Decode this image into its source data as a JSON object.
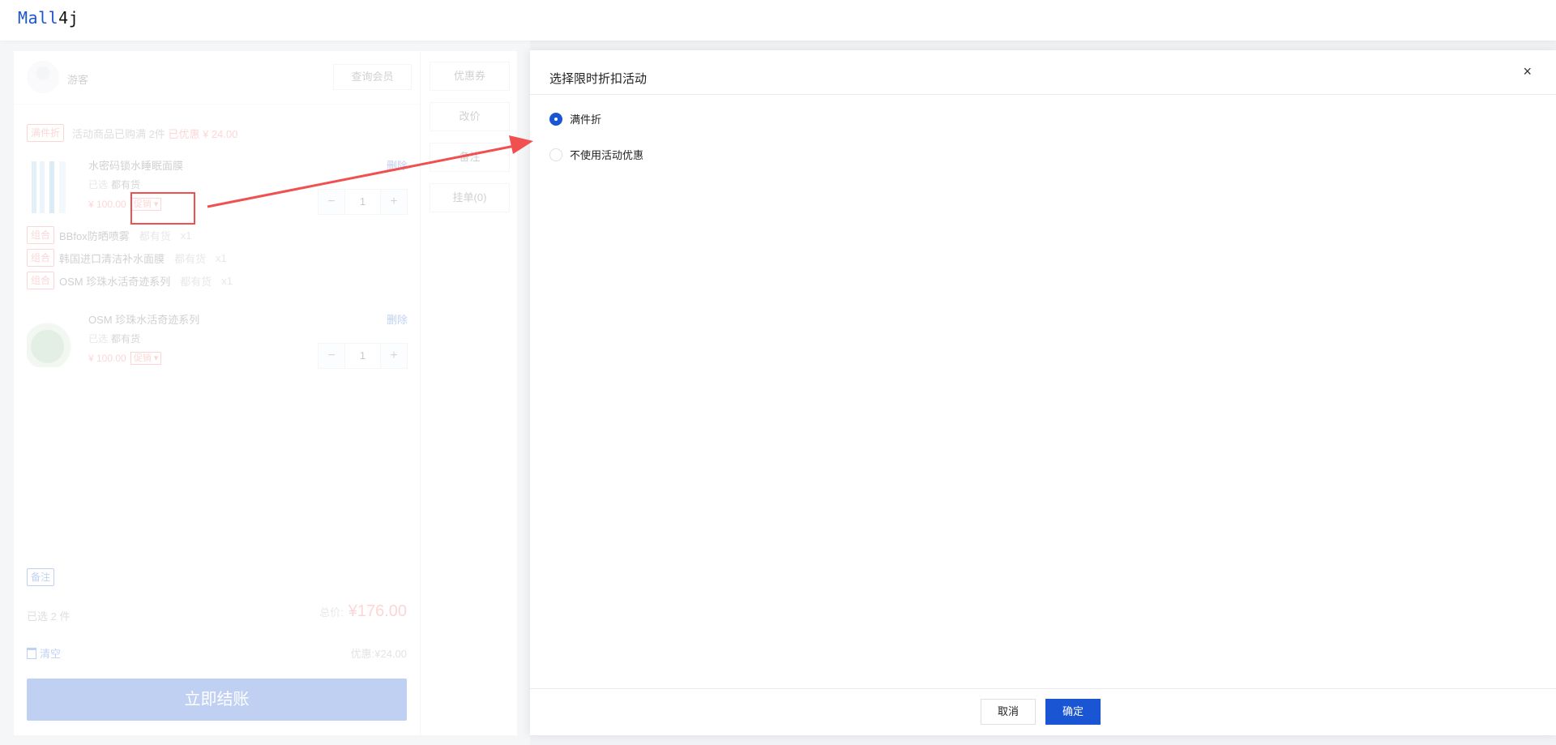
{
  "app": {
    "logo_left": "Mall",
    "logo_right": "4j"
  },
  "member": {
    "guest_label": "游客",
    "query_button": "查询会员"
  },
  "promotion": {
    "tag": "满件折",
    "text": "活动商品已购满 2件",
    "savings": "已优惠 ¥ 24.00"
  },
  "products": [
    {
      "name": "水密码锁水睡眠面膜",
      "selected_label": "已选",
      "stock": "都有货",
      "price": "¥ 100.00",
      "promo_label": "促销",
      "delete_label": "删除",
      "quantity": "1"
    },
    {
      "name": "OSM 珍珠水活奇迹系列",
      "selected_label": "已选",
      "stock": "都有货",
      "price": "¥ 100.00",
      "promo_label": "促销",
      "delete_label": "删除",
      "quantity": "1"
    }
  ],
  "combos": [
    {
      "tag": "组合",
      "name": "BBfox防晒喷雾",
      "stock": "都有货",
      "qty": "x1"
    },
    {
      "tag": "组合",
      "name": "韩国进口清洁补水面膜",
      "stock": "都有货",
      "qty": "x1"
    },
    {
      "tag": "组合",
      "name": "OSM 珍珠水活奇迹系列",
      "stock": "都有货",
      "qty": "x1"
    }
  ],
  "footer": {
    "note_tag": "备注",
    "selected_count": "已选 2 件",
    "total_label": "总价:",
    "total_value": "¥176.00",
    "clear_label": "清空",
    "discount": "优惠:¥24.00",
    "checkout": "立即结账"
  },
  "side_actions": [
    "优惠券",
    "改价",
    "备注",
    "挂单(0)"
  ],
  "drawer": {
    "title": "选择限时折扣活动",
    "close": "×",
    "options": [
      {
        "label": "满件折",
        "checked": true
      },
      {
        "label": "不使用活动优惠",
        "checked": false
      }
    ],
    "cancel": "取消",
    "confirm": "确定"
  },
  "colors": {
    "accent": "#1a55d4",
    "danger": "#f56c6c",
    "annotation": "#f0504f"
  }
}
